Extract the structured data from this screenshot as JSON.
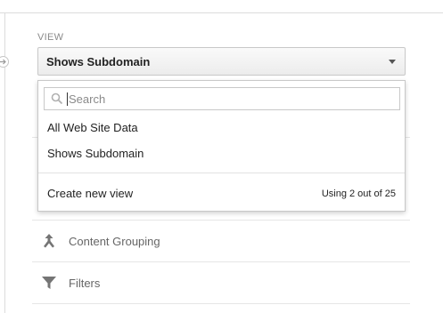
{
  "view": {
    "label": "VIEW",
    "selected": "Shows Subdomain"
  },
  "dropdown": {
    "search_placeholder": "Search",
    "options": [
      {
        "label": "All Web Site Data"
      },
      {
        "label": "Shows Subdomain"
      }
    ],
    "create_link": "Create new view",
    "usage": "Using 2 out of 25"
  },
  "menu": {
    "items": [
      {
        "label": "Content Grouping",
        "icon": "content-grouping-icon"
      },
      {
        "label": "Filters",
        "icon": "filter-icon"
      }
    ]
  }
}
